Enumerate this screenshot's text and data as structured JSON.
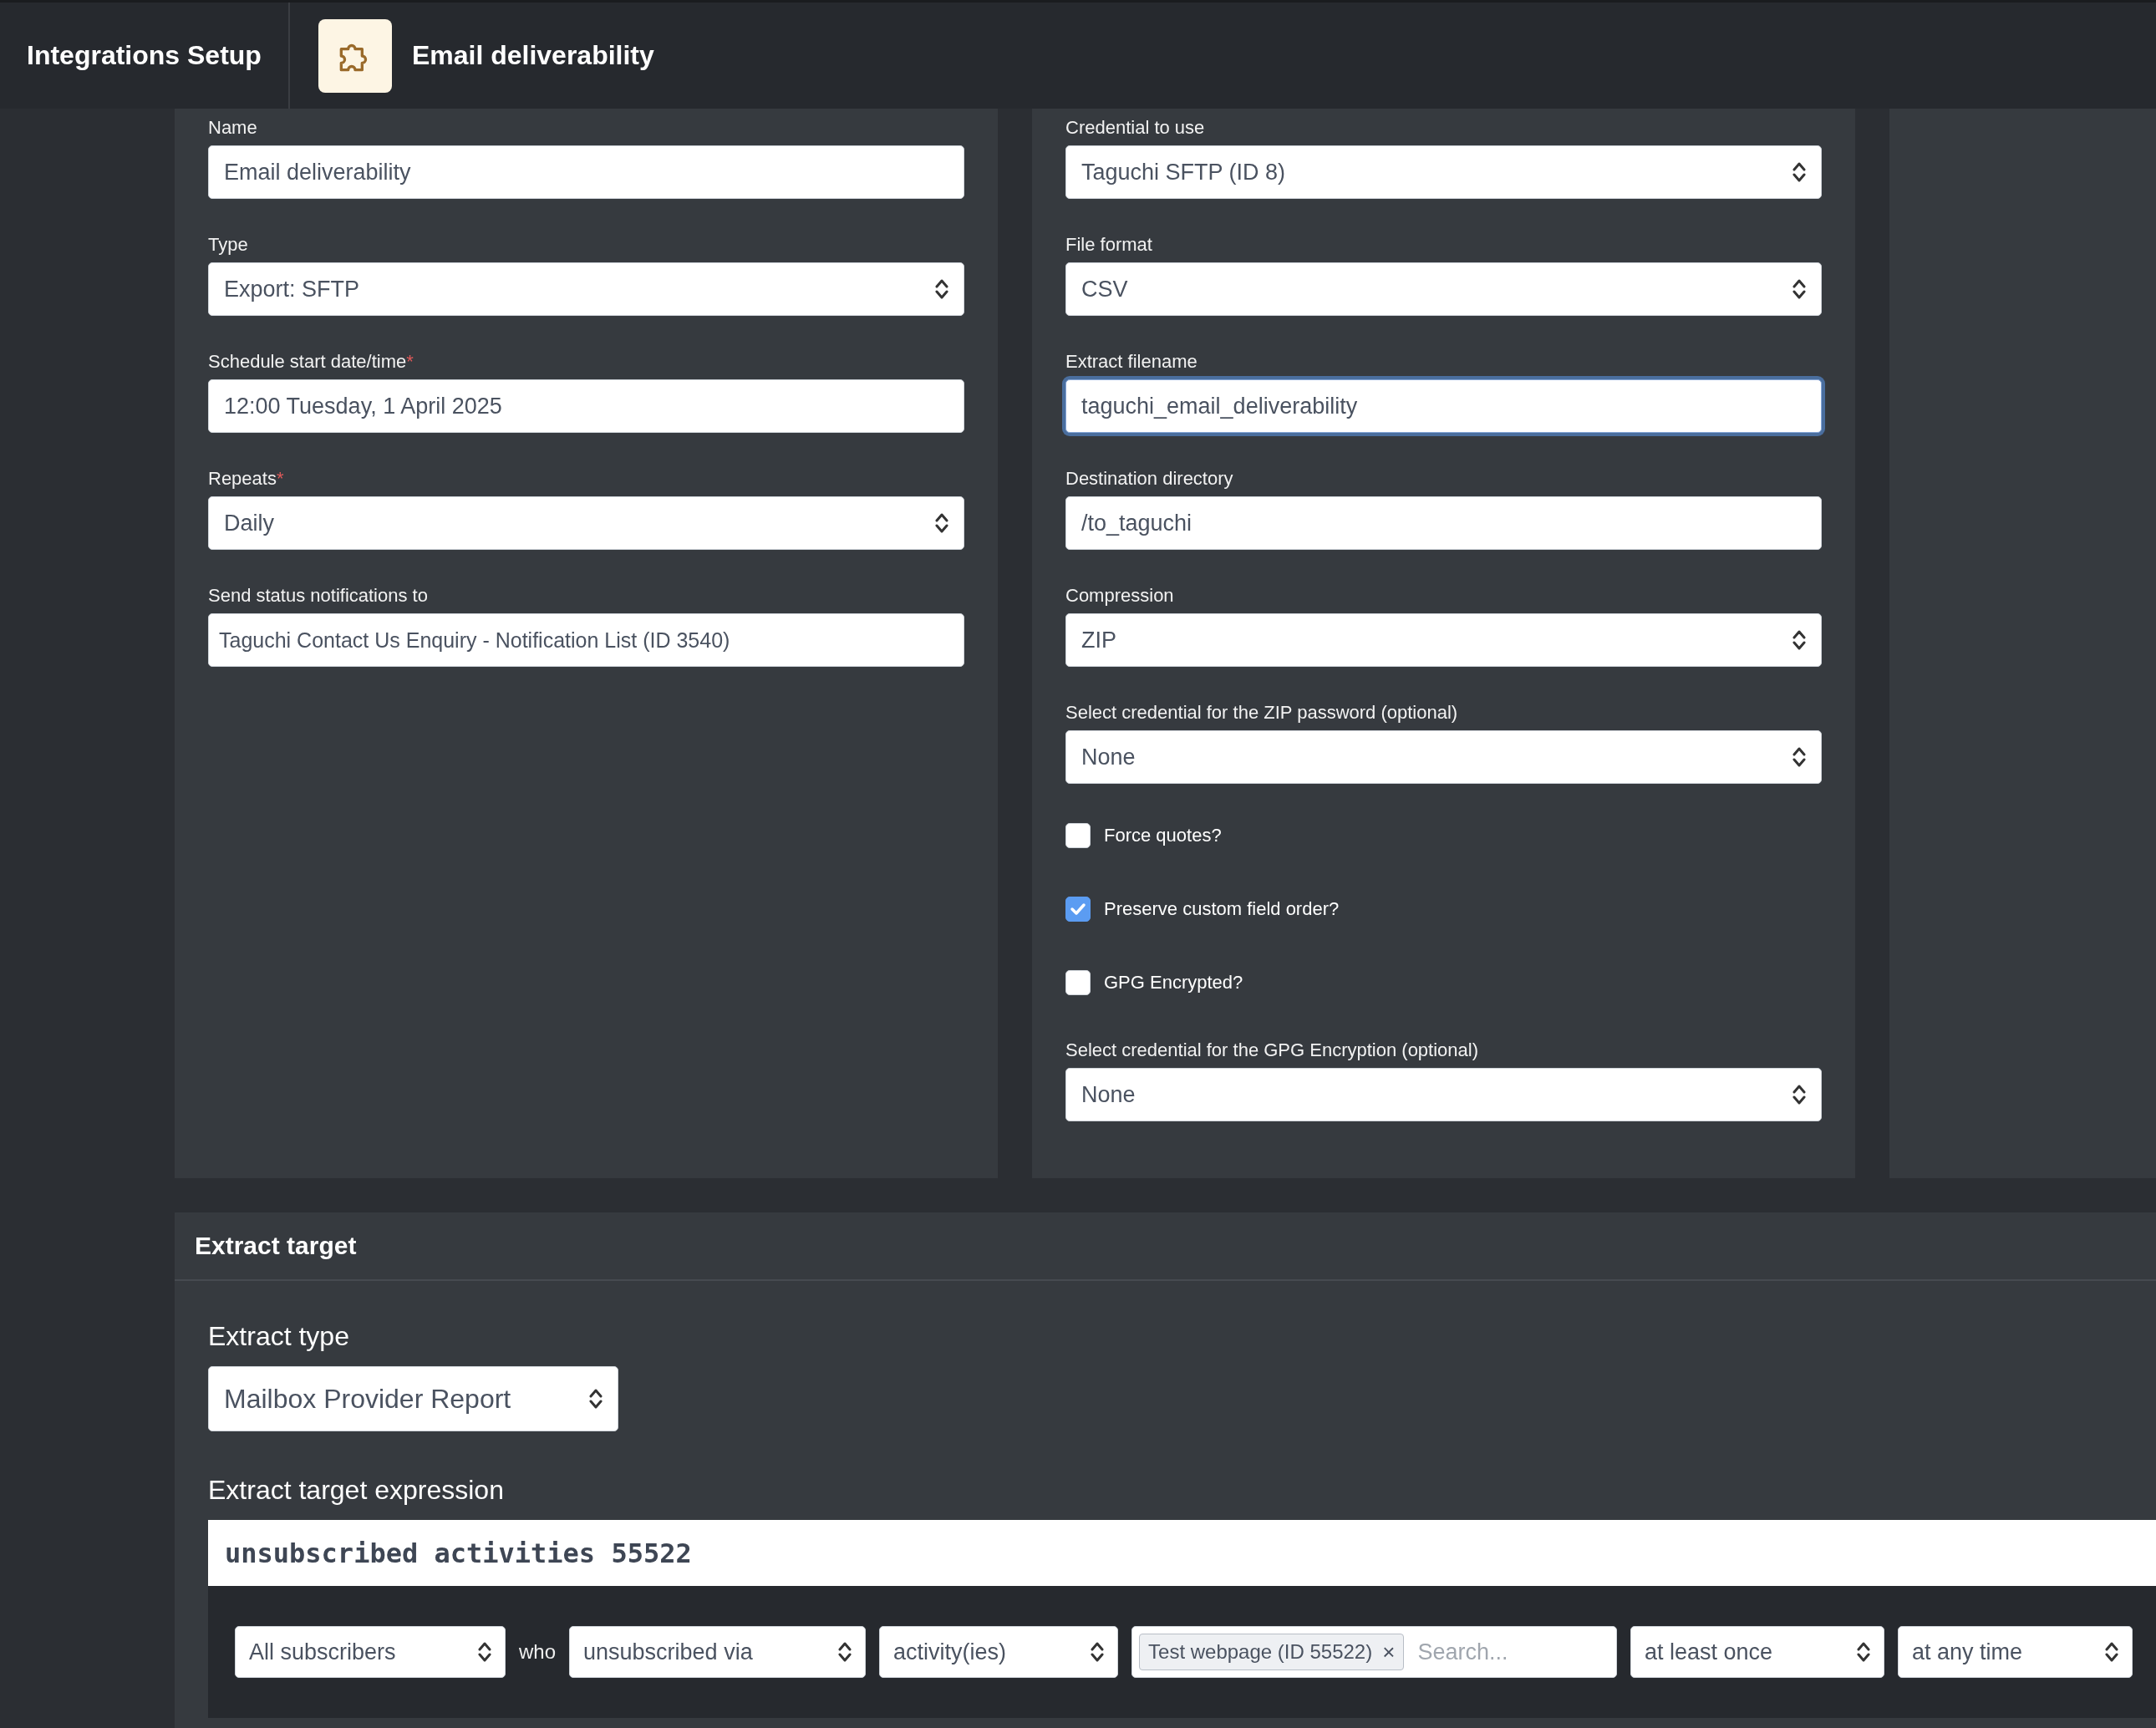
{
  "header": {
    "app_title": "Integrations Setup",
    "page_title": "Email deliverability"
  },
  "left_fields": [
    {
      "kind": "text",
      "label": "Name",
      "value": "Email deliverability"
    },
    {
      "kind": "select",
      "label": "Type",
      "value": "Export: SFTP"
    },
    {
      "kind": "text",
      "label": "Schedule start date/time",
      "required_mark": "*",
      "value": "12:00 Tuesday, 1 April 2025"
    },
    {
      "kind": "select",
      "label": "Repeats",
      "required_mark": "*",
      "value": "Daily"
    },
    {
      "kind": "tag",
      "label": "Send status notifications to",
      "value": "Taguchi Contact Us Enquiry - Notification List (ID 3540)"
    }
  ],
  "right_fields": [
    {
      "kind": "select",
      "label": "Credential to use",
      "value": "Taguchi SFTP (ID 8)"
    },
    {
      "kind": "select",
      "label": "File format",
      "value": "CSV"
    },
    {
      "kind": "text",
      "label": "Extract filename",
      "value": "taguchi_email_deliverability",
      "focused": true
    },
    {
      "kind": "text",
      "label": "Destination directory",
      "value": "/to_taguchi"
    },
    {
      "kind": "select",
      "label": "Compression",
      "value": "ZIP"
    },
    {
      "kind": "select",
      "label": "Select credential for the ZIP password (optional)",
      "value": "None"
    },
    {
      "kind": "checkbox",
      "label": "Force quotes?",
      "checked": false
    },
    {
      "kind": "checkbox",
      "label": "Preserve custom field order?",
      "checked": true
    },
    {
      "kind": "checkbox",
      "label": "GPG Encrypted?",
      "checked": false
    },
    {
      "kind": "select",
      "label": "Select credential for the GPG Encryption (optional)",
      "value": "None"
    }
  ],
  "extract_target": {
    "title": "Extract target",
    "extract_type": {
      "label": "Extract type",
      "value": "Mailbox Provider Report"
    },
    "expression": {
      "label": "Extract target expression",
      "value": "unsubscribed activities 55522"
    },
    "builder": [
      {
        "kind": "select",
        "value": "All subscribers"
      },
      {
        "kind": "word",
        "value": "who"
      },
      {
        "kind": "select",
        "value": "unsubscribed via"
      },
      {
        "kind": "select",
        "value": "activity(ies)"
      },
      {
        "kind": "tags",
        "tags": [
          "Test webpage (ID 55522)"
        ],
        "remove_mark": "×",
        "placeholder": "Search..."
      },
      {
        "kind": "select",
        "value": "at least once"
      },
      {
        "kind": "select",
        "value": "at any time"
      }
    ]
  }
}
